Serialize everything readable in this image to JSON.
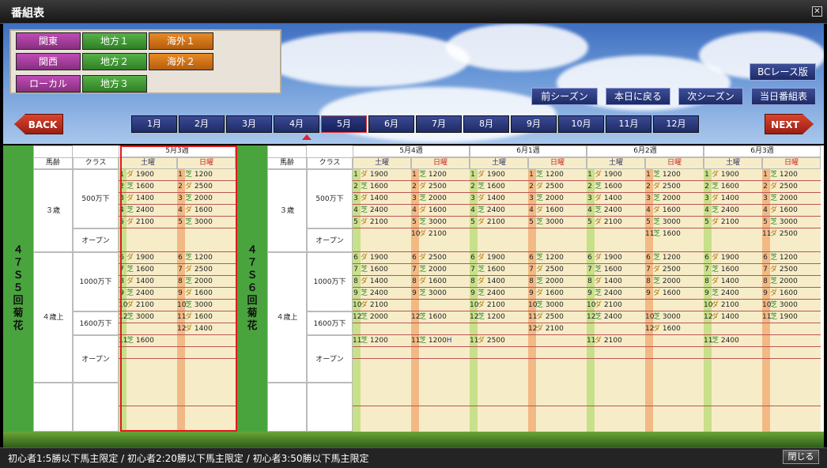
{
  "window": {
    "title": "番組表",
    "close_icon": "close-icon"
  },
  "categories": [
    {
      "label": "関東",
      "color": "purple"
    },
    {
      "label": "地方１",
      "color": "green"
    },
    {
      "label": "海外１",
      "color": "orange"
    },
    {
      "label": "関西",
      "color": "purple"
    },
    {
      "label": "地方２",
      "color": "green"
    },
    {
      "label": "海外２",
      "color": "orange"
    },
    {
      "label": "ローカル",
      "color": "purple"
    },
    {
      "label": "地方３",
      "color": "green"
    }
  ],
  "buttons": {
    "bc": "BCレース版",
    "prev_season": "前シーズン",
    "today": "本日に戻る",
    "next_season": "次シーズン",
    "today_schedule": "当日番組表",
    "back": "BACK",
    "next": "NEXT",
    "close": "閉じる"
  },
  "months": [
    "1月",
    "2月",
    "3月",
    "4月",
    "5月",
    "6月",
    "7月",
    "8月",
    "9月",
    "10月",
    "11月",
    "12月"
  ],
  "selected_month": "5月",
  "headers": {
    "age": "馬齢",
    "cls": "クラス",
    "sat": "土曜",
    "sun": "日曜"
  },
  "left": {
    "side": "４７Ｓ５回菊花",
    "week": "5月3週"
  },
  "right": {
    "side": "４７Ｓ６回菊花",
    "weeks": [
      "5月4週",
      "6月1週",
      "6月2週",
      "6月3週"
    ]
  },
  "ages": {
    "a3": "３歳",
    "a4": "４歳上"
  },
  "classes": {
    "c500": "500万下",
    "open": "オープン",
    "c1000": "1000万下",
    "c1600": "1600万下"
  },
  "footer": "初心者1:5勝以下馬主限定 / 初心者2:20勝以下馬主限定 / 初心者3:50勝以下馬主限定",
  "week_53": {
    "sat": [
      "1|ダ|1900",
      "2|芝|1600",
      "3|ダ|1400",
      "4|芝|2400",
      "5|ダ|2100",
      "",
      "6|ダ|1900",
      "7|芝|1600",
      "8|ダ|1400",
      "9|芝|2400",
      "10|ダ|2100",
      "12|芝|3000",
      "",
      "11|芝|1600",
      "",
      ""
    ],
    "sun": [
      "1|芝|1200",
      "2|ダ|2500",
      "3|芝|2000",
      "4|ダ|1600",
      "5|芝|3000",
      "",
      "6|芝|1200",
      "7|ダ|2500",
      "8|芝|2000",
      "9|ダ|1600",
      "10|芝|3000",
      "11|ダ|1600",
      "12|ダ|1400",
      "",
      "",
      ""
    ]
  },
  "weeks": [
    {
      "sat": [
        "1|ダ|1900",
        "2|芝|1600",
        "3|ダ|1400",
        "4|芝|2400",
        "5|ダ|2100",
        "",
        "6|ダ|1900",
        "7|芝|1600",
        "8|ダ|1400",
        "9|芝|2400",
        "10|ダ|2100",
        "12|芝|2000",
        "",
        "11|芝|1200",
        "",
        ""
      ],
      "sun": [
        "1|芝|1200",
        "2|ダ|2500",
        "3|芝|2000",
        "4|ダ|1600",
        "5|芝|3000",
        "10|ダ|2100",
        "6|ダ|2500",
        "7|芝|2000",
        "8|ダ|1600",
        "9|芝|3000",
        "",
        "12|芝|1600",
        "",
        "11|芝|1200H",
        "",
        ""
      ]
    },
    {
      "sat": [
        "1|ダ|1900",
        "2|芝|1600",
        "3|ダ|1400",
        "4|芝|2400",
        "5|ダ|2100",
        "",
        "6|ダ|1900",
        "7|芝|1600",
        "8|ダ|1400",
        "9|芝|2400",
        "10|ダ|2100",
        "12|芝|1200",
        "",
        "11|ダ|2500",
        "",
        ""
      ],
      "sun": [
        "1|芝|1200",
        "2|ダ|2500",
        "3|芝|2000",
        "4|ダ|1600",
        "5|芝|3000",
        "",
        "6|芝|1200",
        "7|ダ|2500",
        "8|芝|2000",
        "9|ダ|1600",
        "10|芝|3000",
        "11|ダ|2500",
        "12|ダ|2100",
        "",
        "",
        ""
      ]
    },
    {
      "sat": [
        "1|ダ|1900",
        "2|芝|1600",
        "3|ダ|1400",
        "4|芝|2400",
        "5|ダ|2100",
        "",
        "6|ダ|1900",
        "7|芝|1600",
        "8|ダ|1400",
        "9|芝|2400",
        "10|ダ|2100",
        "12|芝|2400",
        "",
        "11|ダ|2100",
        "",
        ""
      ],
      "sun": [
        "1|芝|1200",
        "2|ダ|2500",
        "3|芝|2000",
        "4|ダ|1600",
        "5|芝|3000",
        "11|芝|1600",
        "6|芝|1200",
        "7|ダ|2500",
        "8|芝|2000",
        "9|ダ|1600",
        "",
        "10|芝|3000",
        "12|ダ|1600",
        "",
        "",
        ""
      ]
    },
    {
      "sat": [
        "1|ダ|1900",
        "2|芝|1600",
        "3|ダ|1400",
        "4|芝|2400",
        "5|ダ|2100",
        "",
        "6|ダ|1900",
        "7|芝|1600",
        "8|ダ|1400",
        "9|芝|2400",
        "10|ダ|2100",
        "12|ダ|1400",
        "",
        "11|芝|2400",
        "",
        ""
      ],
      "sun": [
        "1|芝|1200",
        "2|ダ|2500",
        "3|芝|2000",
        "4|ダ|1600",
        "5|芝|3000",
        "11|ダ|2500",
        "6|芝|1200",
        "7|ダ|2500",
        "8|芝|2000",
        "9|ダ|1600",
        "10|芝|3000",
        "11|芝|1900",
        "",
        "",
        "",
        ""
      ]
    }
  ]
}
